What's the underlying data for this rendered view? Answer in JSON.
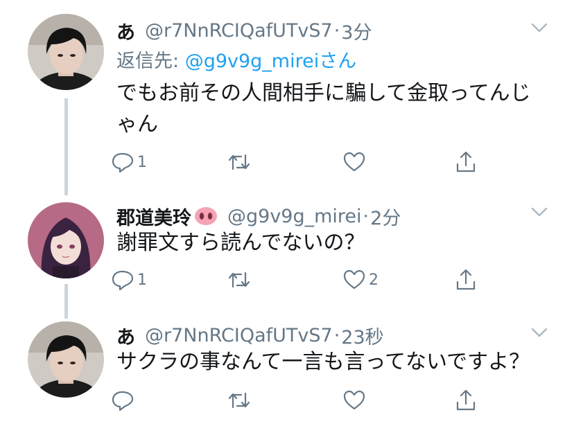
{
  "tweets": [
    {
      "name": "あ",
      "handle": "@r7NnRCIQafUTvS7",
      "dot": "·",
      "time": "3分",
      "reply_prefix": "返信先: ",
      "reply_mention": "@g9v9g_mirei",
      "reply_suffix": "さん",
      "text": "でもお前その人間相手に騙して金取ってんじゃん",
      "reply_count": "1",
      "retweet_count": "",
      "like_count": ""
    },
    {
      "name": "郡道美玲",
      "name_emoji": "pig-nose-emoji",
      "handle": "@g9v9g_mirei",
      "dot": "·",
      "time": "2分",
      "text": "謝罪文すら読んでないの？",
      "reply_count": "1",
      "retweet_count": "",
      "like_count": "2"
    },
    {
      "name": "あ",
      "handle": "@r7NnRCIQafUTvS7",
      "dot": "·",
      "time": "23秒",
      "text": "サクラの事なんて一言も言ってないですよ？",
      "reply_count": "",
      "retweet_count": "",
      "like_count": ""
    }
  ],
  "colors": {
    "text": "#14171a",
    "secondary": "#657786",
    "link": "#1da1f2",
    "thread_line": "#ccd6dd"
  },
  "icons": [
    "reply-icon",
    "retweet-icon",
    "like-icon",
    "share-icon",
    "chevron-down-icon"
  ]
}
